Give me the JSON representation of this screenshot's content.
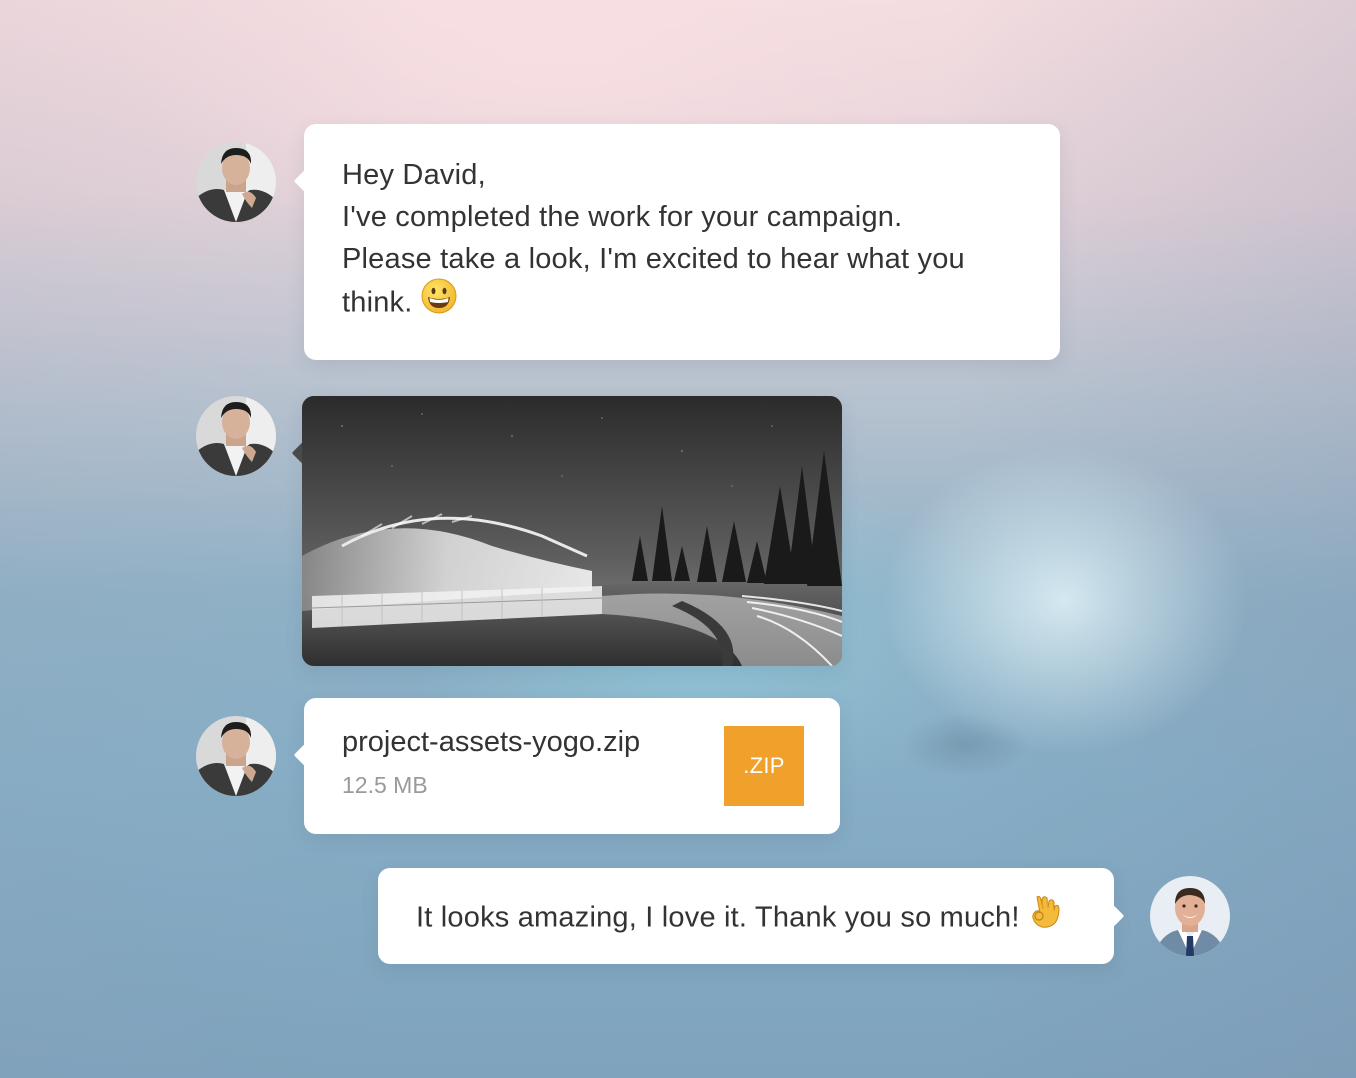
{
  "messages": [
    {
      "sender": "contact",
      "type": "text",
      "lines": [
        "Hey David,",
        "I've completed the work for your campaign.",
        "Please take a look, I'm excited to hear what you",
        "think."
      ],
      "emoji": "grinning-face-emoji"
    },
    {
      "sender": "contact",
      "type": "image",
      "image": "stadium-night-photo"
    },
    {
      "sender": "contact",
      "type": "file",
      "file_name": "project-assets-yogo.zip",
      "file_size": "12.5 MB",
      "file_badge": ".ZIP",
      "badge_color": "#f0a12c"
    },
    {
      "sender": "me",
      "type": "text",
      "text": "It looks amazing, I love it. Thank you so much!",
      "emoji": "ok-hand-emoji"
    }
  ],
  "colors": {
    "bubble": "#ffffff",
    "text": "#333333",
    "muted_text": "#9a9a9a"
  }
}
